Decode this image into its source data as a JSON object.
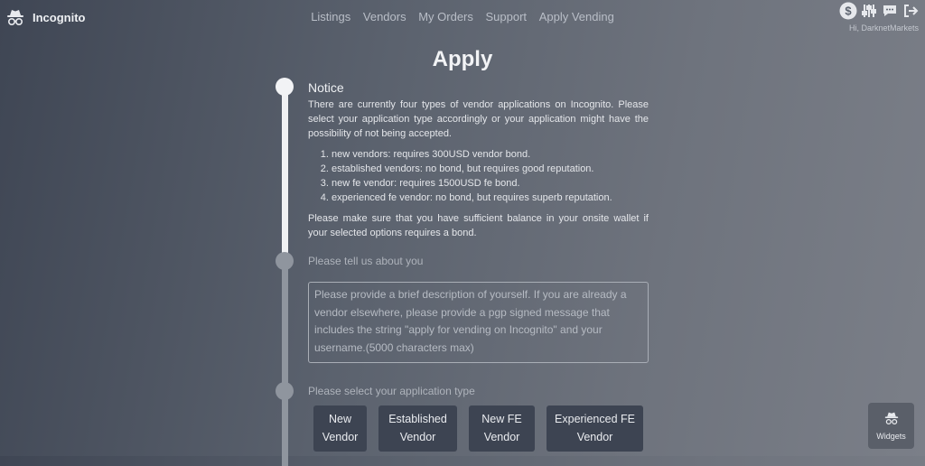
{
  "brand": {
    "name": "Incognito",
    "icon": "incognito-icon"
  },
  "nav": {
    "items": [
      "Listings",
      "Vendors",
      "My Orders",
      "Support",
      "Apply Vending"
    ]
  },
  "header_icons": [
    "dollar-icon",
    "sliders-icon",
    "chat-icon",
    "logout-icon"
  ],
  "greeting": "Hi, DarknetMarkets",
  "page_title": "Apply",
  "notice": {
    "heading": "Notice",
    "intro": "There are currently four types of vendor applications on Incognito. Please select your application type accordingly or your application might have the possibility of not being accepted.",
    "items": [
      "new vendors: requires 300USD vendor bond.",
      "established vendors: no bond, but requires good reputation.",
      "new fe vendor: requires 1500USD fe bond.",
      "experienced fe vendor: no bond, but requires superb reputation."
    ],
    "outro": "Please make sure that you have sufficient balance in your onsite wallet if your selected options requires a bond."
  },
  "about": {
    "heading": "Please tell us about you",
    "placeholder": "Please provide a brief description of yourself. If you are already a vendor elsewhere, please provide a pgp signed message that includes the string \"apply for vending on Incognito\" and your username.(5000 characters max)"
  },
  "app_type": {
    "heading": "Please select your application type",
    "options": [
      {
        "line1": "New",
        "line2": "Vendor"
      },
      {
        "line1": "Established",
        "line2": "Vendor"
      },
      {
        "line1": "New FE",
        "line2": "Vendor"
      },
      {
        "line1": "Experienced FE",
        "line2": "Vendor"
      }
    ]
  },
  "widgets": {
    "label": "Widgets",
    "icon": "incognito-icon"
  },
  "colors": {
    "background": "#5b626e",
    "button": "#3d4452",
    "timeline_active": "#f0f1f3",
    "timeline_inactive": "#8f959e"
  }
}
